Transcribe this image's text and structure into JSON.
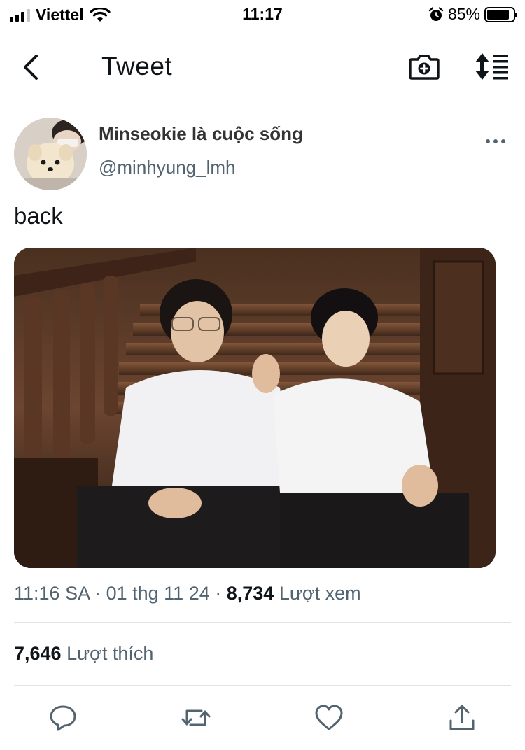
{
  "status_bar": {
    "carrier": "Viettel",
    "time": "11:17",
    "battery_percent": "85%",
    "battery_level": 0.85,
    "signal_bars_active": 3,
    "signal_bars_total": 4,
    "icons": [
      "signal-icon",
      "wifi-icon",
      "alarm-icon",
      "battery-icon"
    ]
  },
  "nav": {
    "title": "Tweet",
    "icons": [
      "back-chevron-icon",
      "camera-plus-icon",
      "sort-icon"
    ]
  },
  "tweet": {
    "display_name": "Minseokie là cuộc sống",
    "handle": "@minhyung_lmh",
    "text": "back",
    "time": "11:16 SA",
    "separator": " · ",
    "date": "01 thg 11 24",
    "views_count": "8,734",
    "views_label": "Lượt xem",
    "likes_count": "7,646",
    "likes_label": "Lượt thích"
  },
  "actions": {
    "icons": [
      "reply-icon",
      "retweet-icon",
      "like-icon",
      "share-icon"
    ]
  },
  "colors": {
    "text_primary": "#0f1419",
    "text_secondary": "#536471",
    "divider": "#e1e4e6"
  }
}
